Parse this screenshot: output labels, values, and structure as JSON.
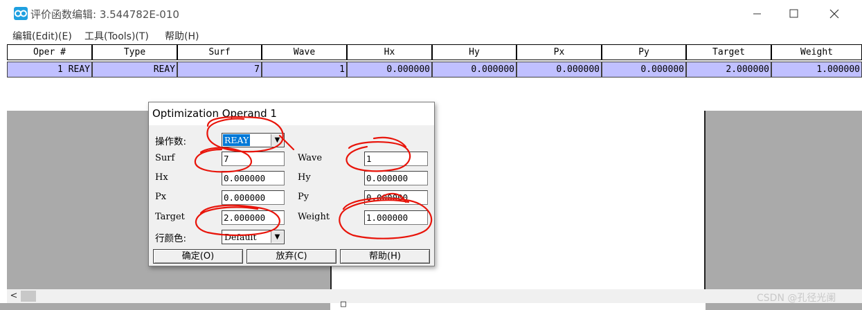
{
  "window": {
    "title": "评价函数编辑: 3.544782E-010",
    "icon": "app-logo-icon"
  },
  "menu": {
    "edit": "编辑(Edit)(E)",
    "tools": "工具(Tools)(T)",
    "help": "帮助(H)"
  },
  "table": {
    "headers": [
      "Oper #",
      "Type",
      "Surf",
      "Wave",
      "Hx",
      "Hy",
      "Px",
      "Py",
      "Target",
      "Weight"
    ],
    "rows": [
      [
        "1 REAY",
        "REAY",
        "7",
        "1",
        "0.000000",
        "0.000000",
        "0.000000",
        "0.000000",
        "2.000000",
        "1.000000"
      ]
    ],
    "row_color": "#c0c0ff"
  },
  "dialog": {
    "title": "Optimization Operand 1",
    "operand_label": "操作数:",
    "operand_value": "REAY",
    "surf_label": "Surf",
    "surf_value": "7",
    "wave_label": "Wave",
    "wave_value": "1",
    "hx_label": "Hx",
    "hx_value": "0.000000",
    "hy_label": "Hy",
    "hy_value": "0.000000",
    "px_label": "Px",
    "px_value": "0.000000",
    "py_label": "Py",
    "py_value": "0.000000",
    "target_label": "Target",
    "target_value": "2.000000",
    "weight_label": "Weight",
    "weight_value": "1.000000",
    "rowcolor_label": "行颜色:",
    "rowcolor_value": "Default",
    "ok_button": "确定(O)",
    "cancel_button": "放弃(C)",
    "help_button": "帮助(H)"
  },
  "scrollbar": {
    "left_arrow": "<"
  },
  "bottom_glyph": "□",
  "watermark": "CSDN @孔径光阑",
  "annotation_color": "#e8140a"
}
